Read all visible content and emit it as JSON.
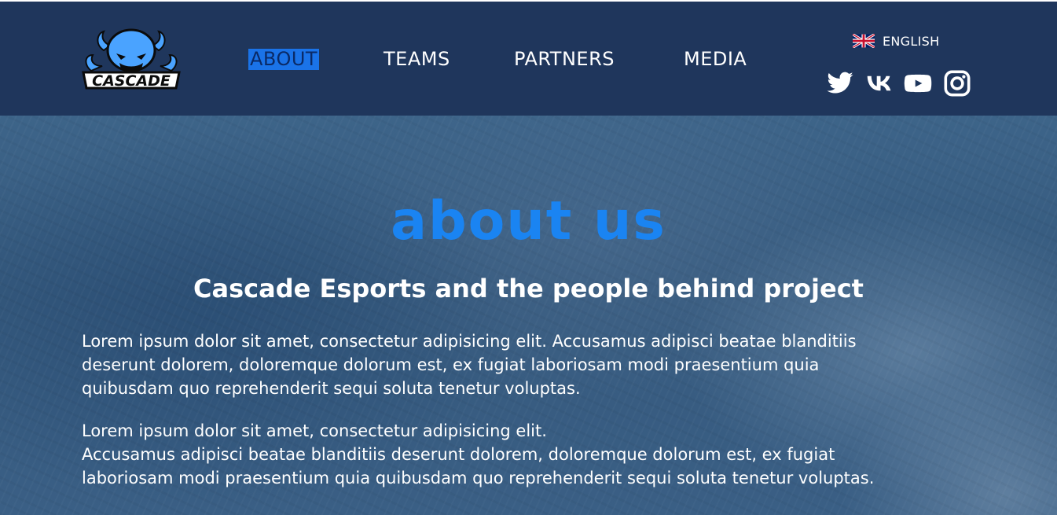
{
  "header": {
    "logo_text": "CASCADE",
    "nav": [
      {
        "label": "ABOUT",
        "active": true
      },
      {
        "label": "TEAMS",
        "active": false
      },
      {
        "label": "PARTNERS",
        "active": false
      },
      {
        "label": "MEDIA",
        "active": false
      }
    ],
    "language": {
      "label": "ENGLISH",
      "flag_icon": "uk-flag-icon"
    },
    "social": [
      "twitter-icon",
      "vk-icon",
      "youtube-icon",
      "instagram-icon"
    ]
  },
  "hero": {
    "title": "about us",
    "subtitle": "Cascade Esports and the people behind project",
    "paragraph1": [
      "Lorem ipsum dolor sit amet, consectetur adipisicing elit. Accusamus adipisci beatae blanditiis",
      "deserunt dolorem, doloremque dolorum est, ex fugiat laboriosam modi praesentium quia",
      "quibusdam quo reprehenderit sequi soluta tenetur voluptas."
    ],
    "paragraph2": [
      "Lorem ipsum dolor sit amet, consectetur adipisicing elit.",
      "Accusamus adipisci beatae blanditiis deserunt dolorem, doloremque dolorum est, ex fugiat",
      "laboriosam modi praesentium quia quibusdam quo reprehenderit sequi soluta tenetur voluptas."
    ]
  },
  "colors": {
    "header_bg": "#1f365c",
    "accent": "#1a84f2",
    "nav_active_bg": "#1a73e8",
    "text": "#ffffff"
  }
}
